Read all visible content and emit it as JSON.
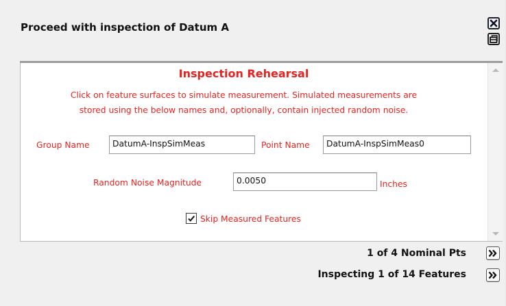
{
  "header": {
    "title": "Proceed with inspection of Datum A",
    "close_icon": "close-icon",
    "restore_icon": "restore-icon"
  },
  "panel": {
    "title": "Inspection Rehearsal",
    "description_line1": "Click on feature surfaces to simulate measurement. Simulated measurements are",
    "description_line2": "stored using the below names and, optionally, contain injected random noise.",
    "group_name_label": "Group Name",
    "group_name_value": "DatumA-InspSimMeas",
    "point_name_label": "Point Name",
    "point_name_value": "DatumA-InspSimMeas0",
    "noise_label": "Random Noise Magnitude",
    "noise_value": "0.0050",
    "noise_unit": "Inches",
    "skip_label": "Skip Measured Features",
    "skip_checked": true
  },
  "footer": {
    "nominal_pts": "1 of 4 Nominal Pts",
    "features": "Inspecting 1 of 14 Features",
    "next_icon": "double-chevron-right-icon"
  },
  "colors": {
    "accent_red": "#e8231f",
    "panel_bg": "#f0f0f0"
  }
}
